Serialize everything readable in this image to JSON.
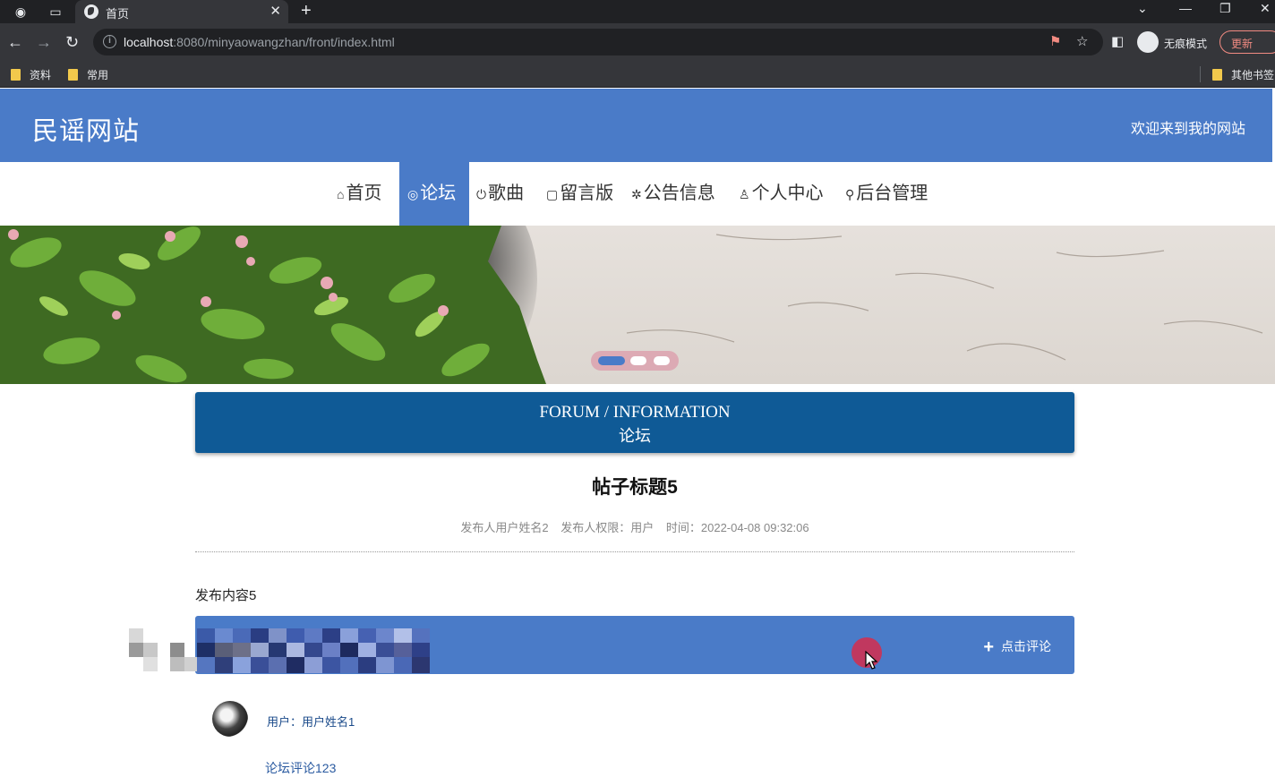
{
  "browser": {
    "tab_title": "首页",
    "url_host": "localhost",
    "url_rest": ":8080/minyaowangzhan/front/index.html",
    "incognito_label": "无痕模式",
    "update_label": "更新",
    "bookmarks": [
      "资料",
      "常用"
    ],
    "other_bookmarks": "其他书签"
  },
  "site": {
    "title": "民谣网站",
    "welcome": "欢迎来到我的网站"
  },
  "nav": {
    "items": [
      {
        "icon": "⌂",
        "label": "首页"
      },
      {
        "icon": "◎",
        "label": "论坛"
      },
      {
        "icon": "⏻",
        "label": "歌曲"
      },
      {
        "icon": "▢",
        "label": "留言版"
      },
      {
        "icon": "✲",
        "label": "公告信息"
      },
      {
        "icon": "♙",
        "label": "个人中心"
      },
      {
        "icon": "⚲",
        "label": "后台管理"
      }
    ],
    "active_index": 1
  },
  "carousel": {
    "slides": 3,
    "active_slide": 1
  },
  "section": {
    "title_en": "FORUM / INFORMATION",
    "title_zh": "论坛"
  },
  "post": {
    "title": "帖子标题5",
    "meta_author": "发布人用户姓名2",
    "meta_role": "发布人权限：用户",
    "meta_time": "时间：2022-04-08 09:32:06",
    "content": "发布内容5"
  },
  "comments": {
    "add_label": "点击评论",
    "items": [
      {
        "user": "用户：用户姓名1",
        "text": "论坛评论123"
      }
    ]
  },
  "colors": {
    "header_blue": "#4a7bc8",
    "section_blue": "#0f5a96",
    "cursor_highlight": "#c0385f"
  }
}
